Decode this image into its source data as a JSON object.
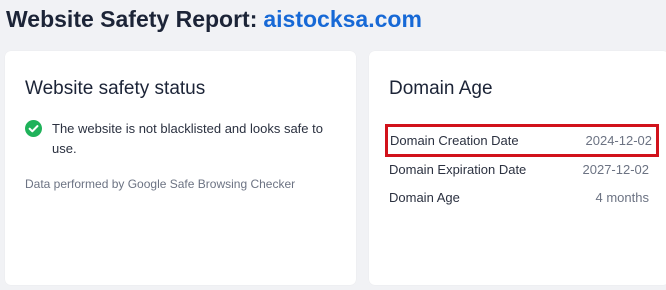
{
  "header": {
    "title_prefix": "Website Safety Report:",
    "domain": "aistocksa.com"
  },
  "safety_card": {
    "title": "Website safety status",
    "status_icon": "check-circle-icon",
    "status_text": "The website is not blacklisted and looks safe to use.",
    "data_source": "Data performed by Google Safe Browsing Checker"
  },
  "age_card": {
    "title": "Domain Age",
    "rows": [
      {
        "label": "Domain Creation Date",
        "value": "2024-12-02",
        "highlighted": true
      },
      {
        "label": "Domain Expiration Date",
        "value": "2027-12-02"
      },
      {
        "label": "Domain Age",
        "value": "4 months"
      }
    ]
  },
  "colors": {
    "accent": "#1769d6",
    "success": "#1fb25a",
    "highlight": "#d1121b",
    "background": "#f1f2f5"
  }
}
